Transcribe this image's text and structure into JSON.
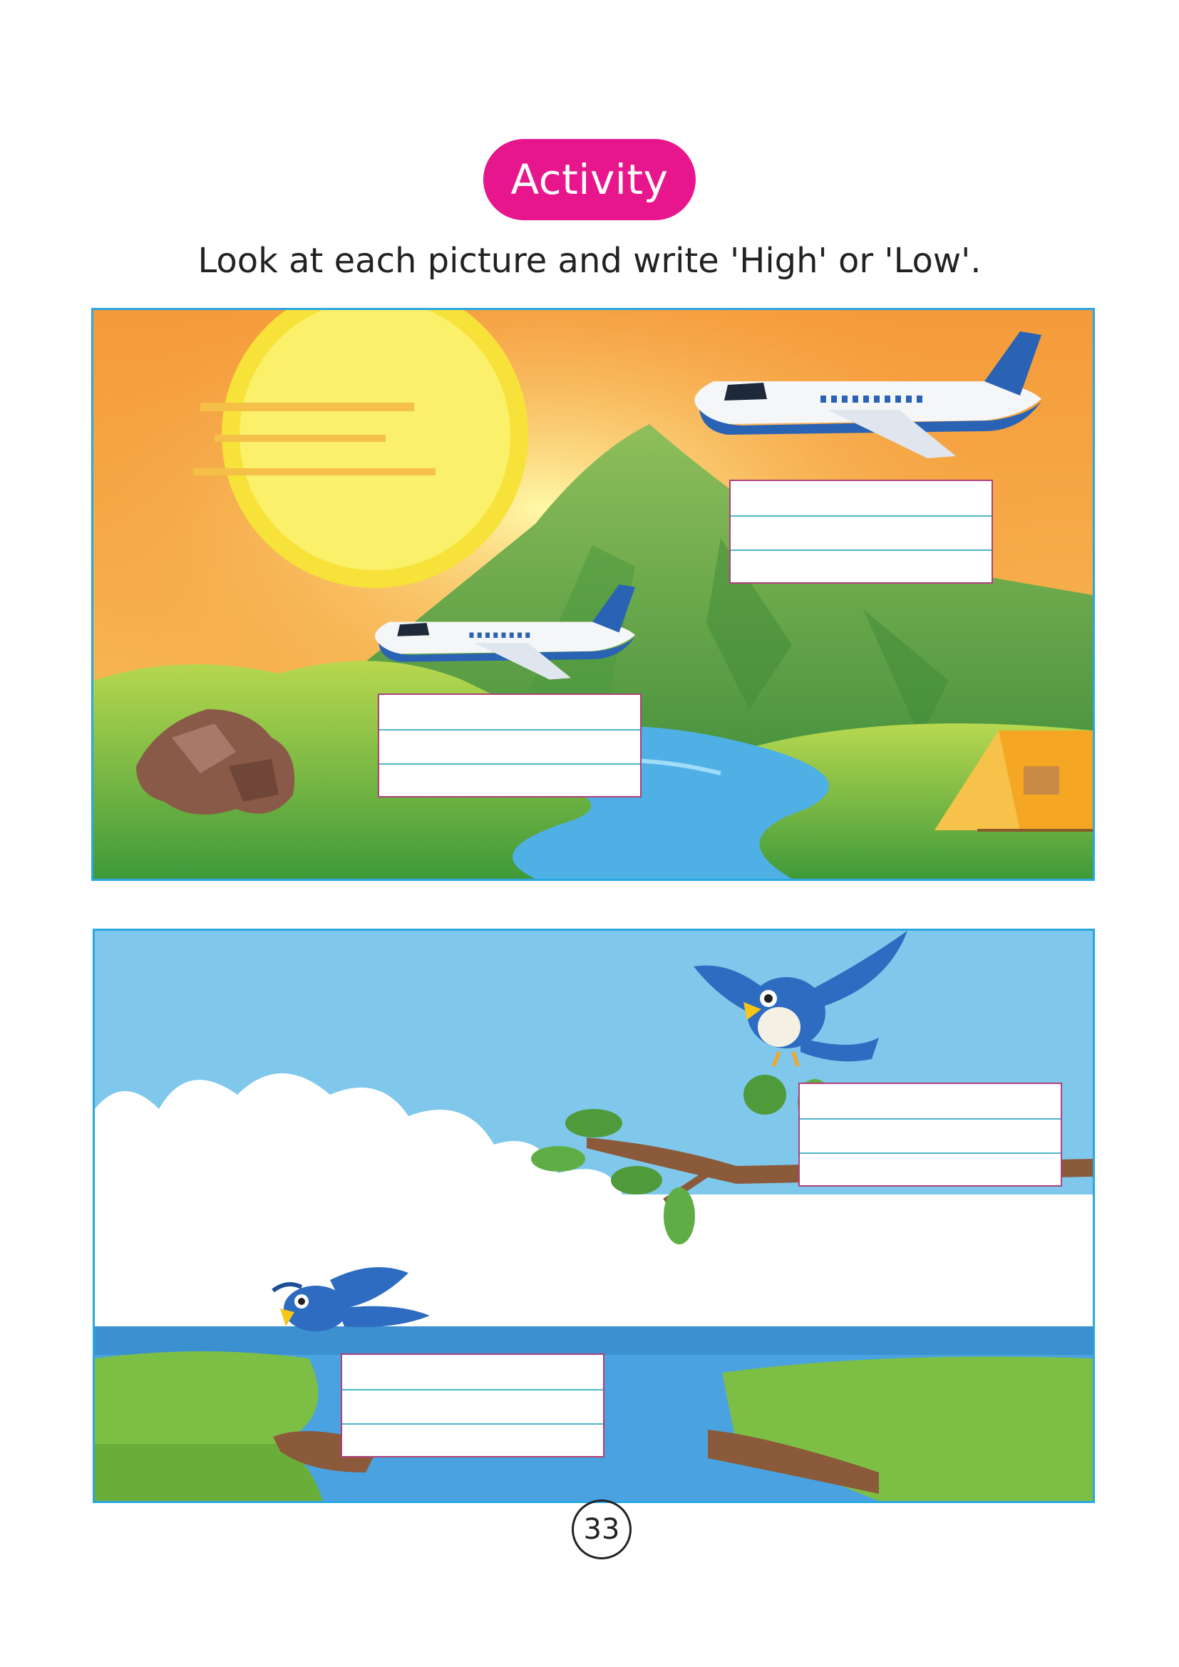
{
  "header": {
    "badge_label": "Activity",
    "instruction": "Look at each picture and write 'High' or 'Low'."
  },
  "scenes": [
    {
      "id": "scene-airplanes",
      "answers": [
        "",
        ""
      ],
      "colors": {
        "sky": "#f59a3a",
        "sun": "#f9f04a",
        "mountain": "#5fa84a",
        "river": "#4fb0e6",
        "tent": "#f5a623"
      }
    },
    {
      "id": "scene-birds",
      "answers": [
        "",
        ""
      ],
      "colors": {
        "sky": "#7fc8ec",
        "cloud": "#ffffff",
        "bird": "#2d6cc0",
        "grass": "#7dbf45",
        "water": "#4aa3e0"
      }
    }
  ],
  "footer": {
    "page_number": "33"
  }
}
